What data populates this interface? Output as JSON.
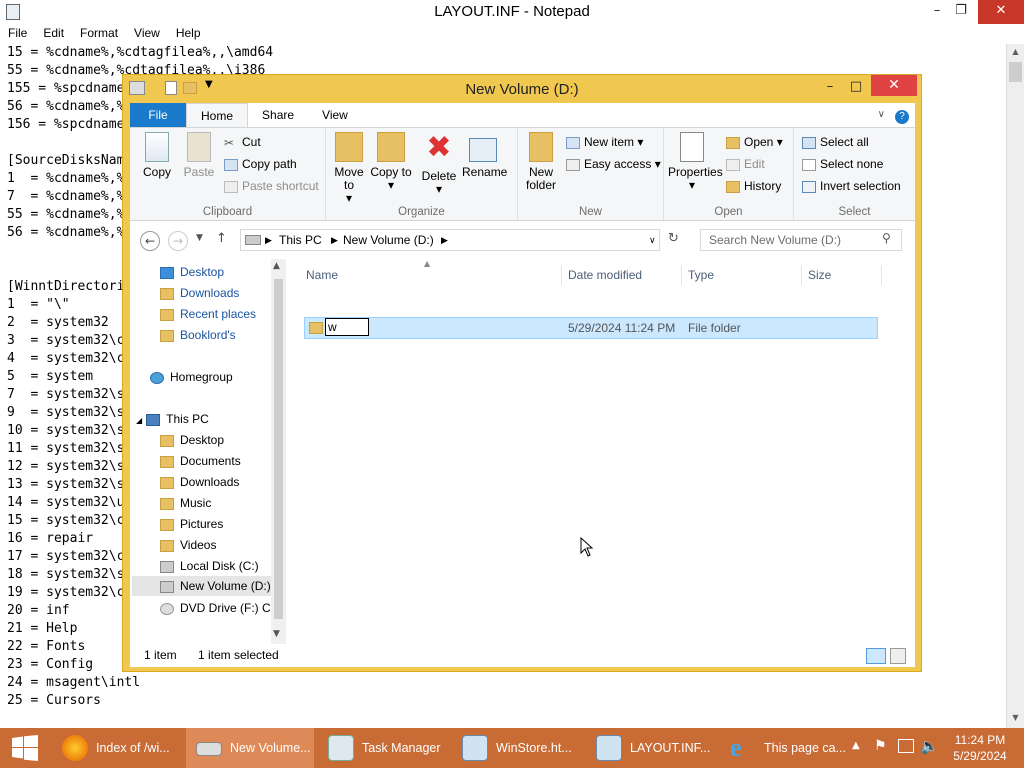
{
  "notepad": {
    "title": "LAYOUT.INF - Notepad",
    "menu": [
      "File",
      "Edit",
      "Format",
      "View",
      "Help"
    ],
    "lines": [
      "15 = %cdname%,%cdtagfilea%,,\\amd64",
      "55 = %cdname%,%cdtagfilea%,,\\i386",
      "155 = %spcdname%",
      "56 = %cdname%,%",
      "156 = %spcdname%",
      "",
      "[SourceDisksNam",
      "1  = %cdname%,%",
      "7  = %cdname%,%",
      "55 = %cdname%,%",
      "56 = %cdname%,%",
      "",
      "",
      "[WinntDirectori",
      "1  = \"\\\"",
      "2  = system32",
      "3  = system32\\c",
      "4  = system32\\c",
      "5  = system",
      "7  = system32\\s",
      "9  = system32\\s",
      "10 = system32\\s",
      "11 = system32\\s",
      "12 = system32\\s",
      "13 = system32\\s",
      "14 = system32\\u",
      "15 = system32\\c",
      "16 = repair",
      "17 = system32\\c",
      "18 = system32\\s",
      "19 = system32\\c",
      "20 = inf",
      "21 = Help",
      "22 = Fonts",
      "23 = Config",
      "24 = msagent\\intl",
      "25 = Cursors"
    ]
  },
  "explorer": {
    "title": "New Volume (D:)",
    "tabs": [
      "File",
      "Home",
      "Share",
      "View"
    ],
    "clipboard": {
      "copy": "Copy",
      "paste": "Paste",
      "cut": "Cut",
      "copy_path": "Copy path",
      "paste_shortcut": "Paste shortcut",
      "label": "Clipboard"
    },
    "organize": {
      "move_to": "Move to",
      "copy_to": "Copy to",
      "delete": "Delete",
      "rename": "Rename",
      "label": "Organize"
    },
    "new": {
      "new_folder": "New folder",
      "new_item": "New item",
      "easy_access": "Easy access",
      "label": "New"
    },
    "open": {
      "properties": "Properties",
      "open": "Open",
      "edit": "Edit",
      "history": "History",
      "label": "Open"
    },
    "select": {
      "select_all": "Select all",
      "select_none": "Select none",
      "invert": "Invert selection",
      "label": "Select"
    },
    "address": {
      "crumbs": [
        "This PC",
        "New Volume (D:)"
      ]
    },
    "search": {
      "placeholder": "Search New Volume (D:)"
    },
    "nav": {
      "favorites": [
        "Desktop",
        "Downloads",
        "Recent places",
        "Booklord's"
      ],
      "homegroup": "Homegroup",
      "thispc": "This PC",
      "pc_items": [
        "Desktop",
        "Documents",
        "Downloads",
        "Music",
        "Pictures",
        "Videos",
        "Local Disk (C:)",
        "New Volume (D:)",
        "DVD Drive (F:) CD"
      ]
    },
    "columns": {
      "name": "Name",
      "date": "Date modified",
      "type": "Type",
      "size": "Size"
    },
    "row": {
      "name_edit": "w",
      "date": "5/29/2024 11:24 PM",
      "type": "File folder"
    },
    "status": {
      "count": "1 item",
      "selected": "1 item selected"
    }
  },
  "taskbar": {
    "items": [
      "Index of /wi...",
      "New Volume...",
      "Task Manager",
      "WinStore.ht...",
      "LAYOUT.INF...",
      "This page ca..."
    ],
    "time": "11:24 PM",
    "date": "5/29/2024"
  }
}
